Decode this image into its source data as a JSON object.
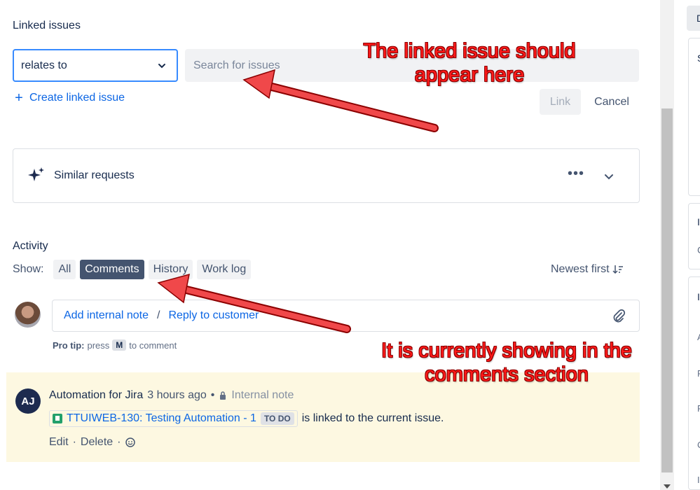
{
  "linked_issues": {
    "title": "Linked issues",
    "relation_value": "relates to",
    "search_placeholder": "Search for issues",
    "create_label": "Create linked issue",
    "link_label": "Link",
    "cancel_label": "Cancel"
  },
  "similar": {
    "label": "Similar requests",
    "more": "•••"
  },
  "activity": {
    "title": "Activity",
    "show_label": "Show:",
    "filters": [
      "All",
      "Comments",
      "History",
      "Work log"
    ],
    "active_filter": "Comments",
    "sort_label": "Newest first",
    "add_internal_note": "Add internal note",
    "separator": "/",
    "reply_to_customer": "Reply to customer",
    "protip_bold": "Pro tip:",
    "protip_pre": "press",
    "protip_key": "M",
    "protip_post": "to comment"
  },
  "comment": {
    "avatar_initials": "AJ",
    "author": "Automation for Jira",
    "time": "3 hours ago",
    "dot": "•",
    "visibility": "Internal note",
    "issue_link": "TTUIWEB-130: Testing Automation - 1",
    "issue_status": "TO DO",
    "message": "is linked to the current issue.",
    "edit": "Edit",
    "delete": "Delete",
    "action_sep": "·"
  },
  "annotations": {
    "top": "The linked issue should appear here",
    "bottom": "It is currently showing in the comments section"
  },
  "right_panel": {
    "letters": [
      "D",
      "S",
      "I",
      "C",
      "I",
      "A",
      "F",
      "F",
      "C",
      "I"
    ]
  },
  "colors": {
    "accent": "#0c66e4",
    "annotation": "#ff1a1a",
    "note_bg": "#fdf8e1",
    "active_pill": "#44546f"
  }
}
